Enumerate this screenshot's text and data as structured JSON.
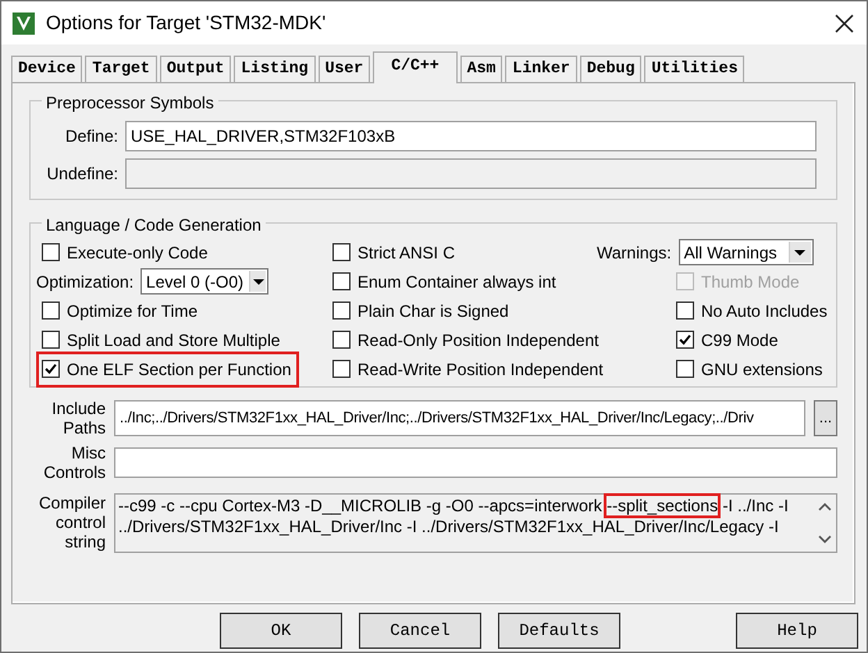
{
  "window": {
    "title": "Options for Target 'STM32-MDK'"
  },
  "tabs": [
    {
      "label": "Device",
      "selected": false
    },
    {
      "label": "Target",
      "selected": false
    },
    {
      "label": "Output",
      "selected": false
    },
    {
      "label": "Listing",
      "selected": false
    },
    {
      "label": "User",
      "selected": false
    },
    {
      "label": "C/C++",
      "selected": true
    },
    {
      "label": "Asm",
      "selected": false
    },
    {
      "label": "Linker",
      "selected": false
    },
    {
      "label": "Debug",
      "selected": false
    },
    {
      "label": "Utilities",
      "selected": false
    }
  ],
  "preprocessor": {
    "title": "Preprocessor Symbols",
    "fields": [
      {
        "label": "Define:",
        "value": "USE_HAL_DRIVER,STM32F103xB",
        "disabled": false
      },
      {
        "label": "Undefine:",
        "disabled": true
      }
    ]
  },
  "language": {
    "title": "Language / Code Generation",
    "columns": [
      [
        {
          "kind": "checkbox",
          "label": "Execute-only Code",
          "checked": false,
          "disabled": false,
          "highlighted": false
        },
        {
          "kind": "dropdown",
          "label": "Optimization:",
          "value": "Level 0 (-O0)"
        },
        {
          "kind": "checkbox",
          "label": "Optimize for Time",
          "checked": false,
          "disabled": false,
          "highlighted": false
        },
        {
          "kind": "checkbox",
          "label": "Split Load and Store Multiple",
          "checked": false,
          "disabled": false,
          "highlighted": false
        },
        {
          "kind": "checkbox",
          "label": "One ELF Section per Function",
          "checked": true,
          "disabled": false,
          "highlighted": true
        }
      ],
      [
        {
          "kind": "checkbox",
          "label": "Strict ANSI C",
          "checked": false,
          "disabled": false,
          "highlighted": false
        },
        {
          "kind": "checkbox",
          "label": "Enum Container always int",
          "checked": false,
          "disabled": false,
          "highlighted": false
        },
        {
          "kind": "checkbox",
          "label": "Plain Char is Signed",
          "checked": false,
          "disabled": false,
          "highlighted": false
        },
        {
          "kind": "checkbox",
          "label": "Read-Only Position Independent",
          "checked": false,
          "disabled": false,
          "highlighted": false
        },
        {
          "kind": "checkbox",
          "label": "Read-Write Position Independent",
          "checked": false,
          "disabled": false,
          "highlighted": false
        }
      ],
      [
        {
          "kind": "dropdown",
          "label": "Warnings:",
          "value": "All Warnings"
        },
        {
          "kind": "checkbox",
          "label": "Thumb Mode",
          "checked": false,
          "disabled": true,
          "highlighted": false
        },
        {
          "kind": "checkbox",
          "label": "No Auto Includes",
          "checked": false,
          "disabled": false,
          "highlighted": false
        },
        {
          "kind": "checkbox",
          "label": "C99 Mode",
          "checked": true,
          "disabled": false,
          "highlighted": false
        },
        {
          "kind": "checkbox",
          "label": "GNU extensions",
          "checked": false,
          "disabled": false,
          "highlighted": false
        }
      ]
    ]
  },
  "include_paths": {
    "label": "Include Paths",
    "value": "../Inc;../Drivers/STM32F1xx_HAL_Driver/Inc;../Drivers/STM32F1xx_HAL_Driver/Inc/Legacy;../Driv",
    "browse": "..."
  },
  "misc_controls": {
    "label": "Misc Controls"
  },
  "compiler_string": {
    "label": "Compiler control string",
    "segments": [
      {
        "text": "--c99 -c --cpu Cortex-M3 -D__MICROLIB -g -O0 --apcs=interwork ",
        "highlighted": false
      },
      {
        "text": "--split_sections",
        "highlighted": true
      },
      {
        "text": " -I ../Inc -I ../Drivers/STM32F1xx_HAL_Driver/Inc -I ../Drivers/STM32F1xx_HAL_Driver/Inc/Legacy -I",
        "highlighted": false
      }
    ]
  },
  "buttons": [
    {
      "label": "OK",
      "kind": "left"
    },
    {
      "label": "Cancel",
      "kind": "left"
    },
    {
      "label": "Defaults",
      "kind": "left"
    },
    {
      "label": "Help",
      "kind": "right"
    }
  ]
}
